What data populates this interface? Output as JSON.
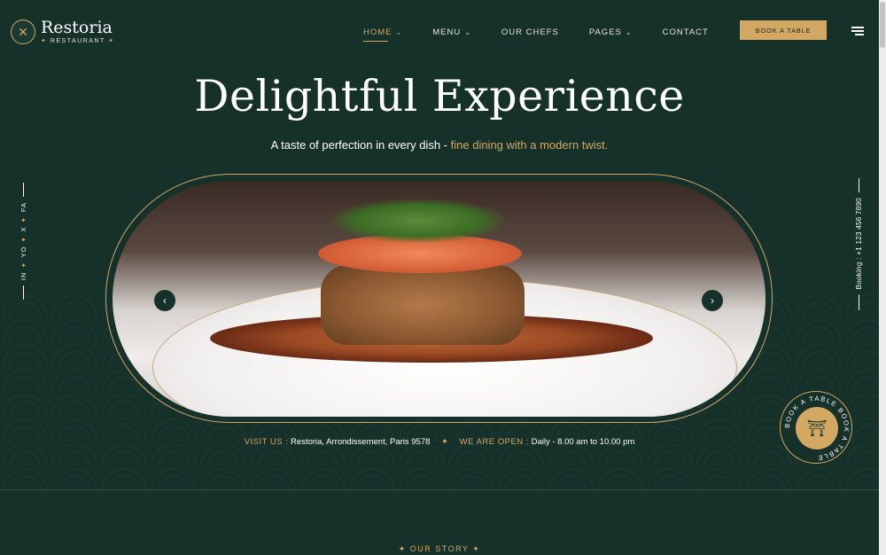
{
  "brand": {
    "name": "Restoria",
    "subtitle": "RESTAURANT",
    "logo_icon": "fork-knife-icon"
  },
  "nav": {
    "items": [
      {
        "label": "HOME",
        "dropdown": true,
        "active": true
      },
      {
        "label": "MENU",
        "dropdown": true,
        "active": false
      },
      {
        "label": "OUR CHEFS",
        "dropdown": false,
        "active": false
      },
      {
        "label": "PAGES",
        "dropdown": true,
        "active": false
      },
      {
        "label": "CONTACT",
        "dropdown": false,
        "active": false
      }
    ],
    "book_label": "BOOK A TABLE"
  },
  "hero": {
    "title": "Delightful Experience",
    "subtitle_plain": "A taste of perfection in every dish - ",
    "subtitle_accent": "fine dining with a modern twist."
  },
  "social": {
    "items": [
      "IN",
      "YO",
      "X",
      "FA"
    ]
  },
  "booking": {
    "label": "Booking : +1 123 456 7890"
  },
  "info": {
    "visit_label": "VISIT US :",
    "visit_value": "Restoria, Arrondissement, Paris 9578",
    "open_label": "WE ARE OPEN :",
    "open_value": "Daily - 8.00 am to 10.00 pm"
  },
  "badge": {
    "text": "BOOK A TABLE BOOK A TABLE",
    "icon": "restaurant-table-icon"
  },
  "story": {
    "label": "OUR STORY"
  },
  "colors": {
    "accent": "#d3a863",
    "background": "#16302a"
  }
}
